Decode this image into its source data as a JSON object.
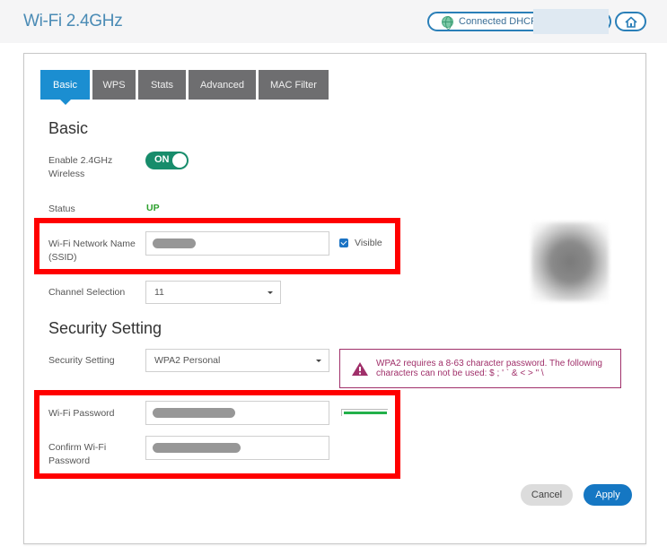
{
  "header": {
    "title": "Wi-Fi 2.4GHz",
    "connection_status": "Connected  DHCP",
    "connection_icon": "globe-icon",
    "home_icon": "home-icon"
  },
  "tabs": [
    {
      "label": "Basic",
      "active": true
    },
    {
      "label": "WPS",
      "active": false
    },
    {
      "label": "Stats",
      "active": false
    },
    {
      "label": "Advanced",
      "active": false
    },
    {
      "label": "MAC Filter",
      "active": false
    }
  ],
  "basic": {
    "heading": "Basic",
    "enable_label": "Enable 2.4GHz Wireless",
    "enable_toggle": "ON",
    "status_label": "Status",
    "status_value": "UP",
    "ssid_label": "Wi-Fi Network Name (SSID)",
    "ssid_value": "",
    "visible_label": "Visible",
    "visible_checked": true,
    "channel_label": "Channel Selection",
    "channel_value": "11"
  },
  "security": {
    "heading": "Security Setting",
    "setting_label": "Security Setting",
    "setting_value": "WPA2 Personal",
    "alert_text": "WPA2 requires a 8-63 character password. The following characters can not be used: $ ; ' ` & < > \" \\",
    "password_label": "Wi-Fi Password",
    "password_value": "",
    "confirm_label": "Confirm Wi-Fi Password",
    "confirm_value": "",
    "password_strength": 1.0,
    "strength_color": "#22b04a"
  },
  "actions": {
    "cancel_label": "Cancel",
    "apply_label": "Apply"
  },
  "colors": {
    "accent": "#1b8ed1",
    "toggle_on": "#178c6b",
    "status_up": "#2ca02c",
    "alert": "#a0306a",
    "highlight": "#ff0000"
  }
}
